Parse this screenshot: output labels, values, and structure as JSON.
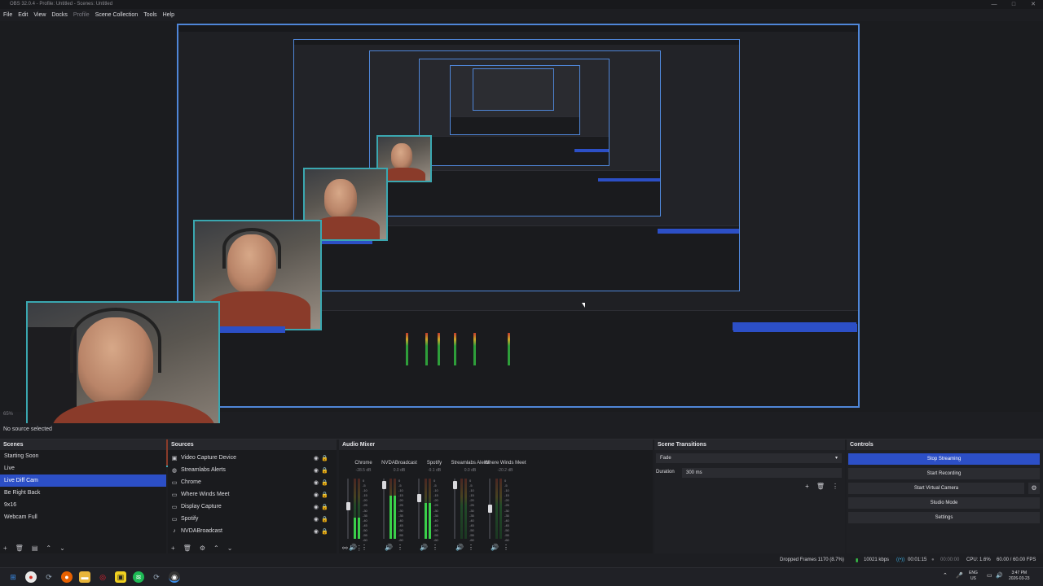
{
  "window": {
    "title": "OBS 32.0.4 - Profile: Untitled - Scenes: Untitled",
    "min": "—",
    "max": "□",
    "close": "✕"
  },
  "menu": {
    "items": [
      "File",
      "Edit",
      "View",
      "Docks",
      "Profile",
      "Scene Collection",
      "Tools",
      "Help"
    ]
  },
  "preview": {
    "scale_label": "65%",
    "no_source": "No source selected"
  },
  "scenes": {
    "title": "Scenes",
    "items": [
      "Starting Soon",
      "Live",
      "Live Diff Cam",
      "Be Right Back",
      "9x16",
      "Webcam Full"
    ],
    "selected_index": 2
  },
  "sources": {
    "title": "Sources",
    "items": [
      {
        "label": "Video Capture Device",
        "icon": "camera-icon"
      },
      {
        "label": "Streamlabs Alerts",
        "icon": "browser-icon"
      },
      {
        "label": "Chrome",
        "icon": "window-icon"
      },
      {
        "label": "Where Winds Meet",
        "icon": "window-icon"
      },
      {
        "label": "Display Capture",
        "icon": "monitor-icon"
      },
      {
        "label": "Spotify",
        "icon": "window-icon"
      },
      {
        "label": "NVDABroadcast",
        "icon": "mic-icon"
      }
    ]
  },
  "mixer": {
    "title": "Audio Mixer",
    "channels": [
      {
        "name": "Chrome",
        "db": "-28.5 dB",
        "level": 0.35,
        "fader": 0.55
      },
      {
        "name": "NVDABroadcast",
        "db": "0.0 dB",
        "level": 0.72,
        "fader": 0.95
      },
      {
        "name": "Spotify",
        "db": "-9.1 dB",
        "level": 0.6,
        "fader": 0.7
      },
      {
        "name": "Streamlabs Alerts",
        "db": "0.0 dB",
        "level": 0.0,
        "fader": 0.95
      },
      {
        "name": "Where Winds Meet",
        "db": "-20.2 dB",
        "level": 0.0,
        "fader": 0.5
      }
    ],
    "scale": [
      "0",
      "-5",
      "-10",
      "-15",
      "-20",
      "-25",
      "-30",
      "-35",
      "-40",
      "-45",
      "-50",
      "-55",
      "-60"
    ]
  },
  "transitions": {
    "title": "Scene Transitions",
    "selected": "Fade",
    "duration_label": "Duration",
    "duration_value": "300 ms"
  },
  "controls": {
    "title": "Controls",
    "stop_streaming": "Stop Streaming",
    "start_recording": "Start Recording",
    "start_virtual_camera": "Start Virtual Camera",
    "studio_mode": "Studio Mode",
    "settings": "Settings"
  },
  "status": {
    "dropped_frames": "Dropped Frames 1170 (8.7%)",
    "bitrate": "10021 kbps",
    "stream_time": "00:01:15",
    "record_time": "00:00:00",
    "cpu": "CPU: 1.6%",
    "fps": "60.00 / 60.00 FPS"
  },
  "taskbar": {
    "lang": "ENG",
    "region": "US",
    "time": "3:47 PM",
    "date": "2026-03-23"
  },
  "colors": {
    "accent": "#2c4fc6",
    "preview_border": "#4f86d8",
    "webcam_border": "#3aa7b0"
  }
}
